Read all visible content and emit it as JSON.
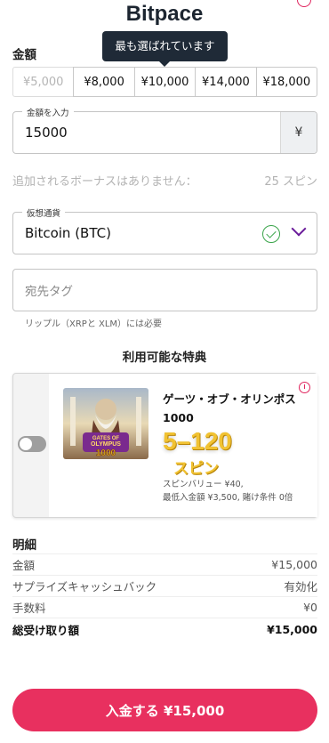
{
  "header": {
    "title": "Bitpace"
  },
  "tooltip": {
    "text": "最も選ばれています"
  },
  "amount": {
    "label": "金額",
    "presets": [
      "¥5,000",
      "¥8,000",
      "¥10,000",
      "¥14,000",
      "¥18,000"
    ],
    "input_label": "金額を入力",
    "input_value": "15000",
    "currency_symbol": "¥"
  },
  "bonus": {
    "text": "追加されるボーナスはありません：",
    "spins": "25 スピン"
  },
  "crypto": {
    "label": "仮想通貨",
    "value": "Bitcoin (BTC)"
  },
  "destination": {
    "placeholder": "宛先タグ",
    "hint": "リップル（XRPと XLM）には必要"
  },
  "offers": {
    "title": "利用可能な特典",
    "game_name": "ゲーツ・オブ・オリンポス 1000",
    "game_logo_text": [
      "GATES OF",
      "OLYMPUS",
      "1000"
    ],
    "spins_range": "5–120",
    "spins_unit": "スピン",
    "spin_value": "スピンバリュー ¥40,",
    "min_deposit": "最低入金額 ¥3,500, 賭け条件 0倍"
  },
  "summary": {
    "title": "明細",
    "rows": [
      {
        "label": "金額",
        "value": "¥15,000"
      },
      {
        "label": "サプライズキャッシュバック",
        "value": "有効化"
      },
      {
        "label": "手数料",
        "value": "¥0"
      }
    ],
    "total_label": "総受け取り額",
    "total_value": "¥15,000"
  },
  "deposit_button": {
    "label": "入金する ¥15,000"
  },
  "colors": {
    "accent": "#e8305f",
    "check": "#3aa44a",
    "chevron": "#6a1b9a",
    "tooltip_bg": "#1f2a37"
  }
}
